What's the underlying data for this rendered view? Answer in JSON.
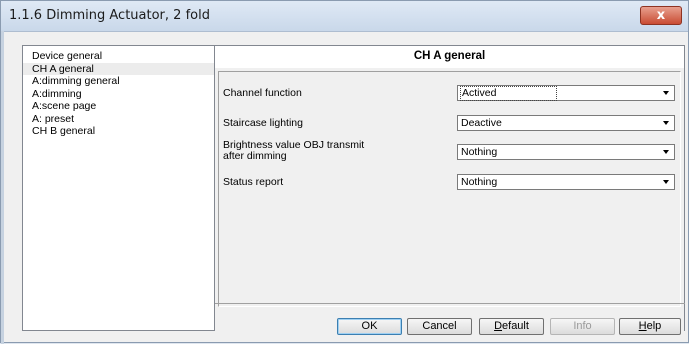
{
  "window": {
    "title": "1.1.6 Dimming Actuator, 2 fold",
    "close_label": "x"
  },
  "nav": {
    "items": [
      {
        "label": "Device general",
        "selected": false
      },
      {
        "label": "CH A general",
        "selected": true
      },
      {
        "label": "A:dimming general",
        "selected": false
      },
      {
        "label": "A:dimming",
        "selected": false
      },
      {
        "label": "A:scene page",
        "selected": false
      },
      {
        "label": "A: preset",
        "selected": false
      },
      {
        "label": "CH B general",
        "selected": false
      }
    ]
  },
  "panel": {
    "title": "CH A general",
    "rows": [
      {
        "label": "Channel function",
        "value": "Actived"
      },
      {
        "label": "Staircase lighting",
        "value": "Deactive"
      },
      {
        "label": "Brightness value OBJ transmit",
        "label2": "after dimming",
        "value": "Nothing"
      },
      {
        "label": "Status report",
        "value": "Nothing"
      }
    ]
  },
  "buttons": {
    "ok": "OK",
    "cancel": "Cancel",
    "default_prefix": "D",
    "default_rest": "efault",
    "info": "Info",
    "help_prefix": "H",
    "help_rest": "elp"
  }
}
